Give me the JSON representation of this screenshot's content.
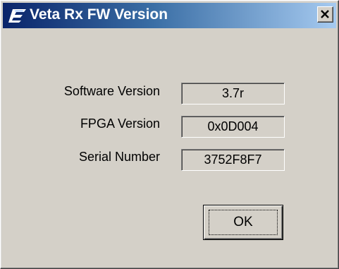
{
  "window": {
    "title": "Veta Rx FW Version",
    "app_icon": "app-logo-icon",
    "close_icon": "close-icon",
    "close_glyph": "×"
  },
  "fields": {
    "software_version": {
      "label": "Software Version",
      "value": "3.7r"
    },
    "fpga_version": {
      "label": "FPGA Version",
      "value": "0x0D004"
    },
    "serial_number": {
      "label": "Serial Number",
      "value": "3752F8F7"
    }
  },
  "buttons": {
    "ok_label": "OK"
  },
  "colors": {
    "titlebar_start": "#0a246a",
    "titlebar_end": "#a6caf0",
    "face": "#d4d0c8"
  }
}
